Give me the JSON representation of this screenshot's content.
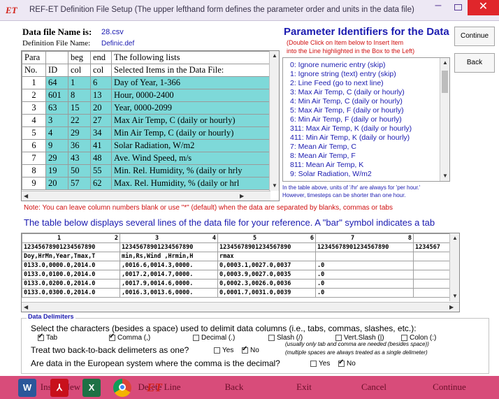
{
  "window": {
    "title": "REF-ET Definition File Setup   (The upper lefthand form defines the parameter order and units in the data file)",
    "app_icon": "ET"
  },
  "file": {
    "data_file_label": "Data file Name is:",
    "data_file_value": "28.csv",
    "def_file_label": "Definition File Name:",
    "def_file_value": "Definic.def"
  },
  "param_table": {
    "header1": [
      "Para",
      "",
      "beg",
      "end",
      "The following lists"
    ],
    "header2": [
      "No.",
      "ID",
      "col",
      "col",
      "Selected Items in the Data File:"
    ],
    "rows": [
      {
        "no": "1",
        "id": "64",
        "beg": "1",
        "end": "6",
        "item": "Day of Year, 1-366"
      },
      {
        "no": "2",
        "id": "601",
        "beg": "8",
        "end": "13",
        "item": "Hour, 0000-2400"
      },
      {
        "no": "3",
        "id": "63",
        "beg": "15",
        "end": "20",
        "item": "Year, 0000-2099"
      },
      {
        "no": "4",
        "id": "3",
        "beg": "22",
        "end": "27",
        "item": "Max Air Temp, C (daily or hourly)"
      },
      {
        "no": "5",
        "id": "4",
        "beg": "29",
        "end": "34",
        "item": "Min Air Temp, C (daily or hourly)"
      },
      {
        "no": "6",
        "id": "9",
        "beg": "36",
        "end": "41",
        "item": "Solar Radiation, W/m2"
      },
      {
        "no": "7",
        "id": "29",
        "beg": "43",
        "end": "48",
        "item": "Ave. Wind Speed, m/s"
      },
      {
        "no": "8",
        "id": "19",
        "beg": "50",
        "end": "55",
        "item": "Min. Rel. Humidity, % (daily or hrly"
      },
      {
        "no": "9",
        "id": "20",
        "beg": "57",
        "end": "62",
        "item": "Max. Rel. Humidity, % (daily or hrl"
      }
    ]
  },
  "param_ids": {
    "title": "Parameter Identifiers for the Data",
    "instr1": "(Double Click on Item below to Insert Item",
    "instr2": "into the Line highlighted in the Box to the Left)",
    "items": [
      "0:    Ignore numeric entry (skip)",
      "1:    Ignore string (text) entry (skip)",
      "2:    Line Feed (go to next line)",
      "3:    Max Air Temp, C (daily or hourly)",
      "4:    Min Air Temp, C (daily or hourly)",
      "5:    Max Air Temp, F (daily or hourly)",
      "6:    Min Air Temp, F (daily or hourly)",
      "311: Max Air Temp, K (daily or hourly)",
      "411: Min Air Temp, K (daily or hourly)",
      "7:    Mean Air Temp, C",
      "8:    Mean Air Temp, F",
      "811: Mean Air Temp, K",
      "9:    Solar Radiation, W/m2"
    ],
    "note1": "In the table above, units of '/hr' are always for 'per hour.'",
    "note2": "However, timesteps can be shorter than one hour."
  },
  "side_buttons": {
    "continue": "Continue",
    "back": "Back"
  },
  "note": "Note: You can leave column numbers blank or use \"*\" (default) when the data are separated by blanks, commas or tabs",
  "preview": {
    "caption": "The table below displays several lines of the data file for your reference. A \"bar\" symbol indicates a tab",
    "ruler_cols": [
      [
        "1",
        "2"
      ],
      [
        "3",
        "4"
      ],
      [
        "5",
        "6"
      ],
      [
        "7",
        "8"
      ]
    ],
    "digits": [
      "12345678901234567890",
      "12345678901234567890",
      "12345678901234567890",
      "12345678901234567890",
      "1234567"
    ],
    "lines": [
      [
        "Doy,HrMn,Year,Tmax,T",
        "min,Rs,Wind ,Hrmin,H",
        "rmax",
        "",
        ""
      ],
      [
        "0133.0,0000.0,2014.0",
        ",0016.6,0014.3,0000.",
        "0,0003.1,0027.0,0037",
        ".0",
        ""
      ],
      [
        "0133.0,0100.0,2014.0",
        ",0017.2,0014.7,0000.",
        "0,0003.9,0027.0,0035",
        ".0",
        ""
      ],
      [
        "0133.0,0200.0,2014.0",
        ",0017.9,0014.6,0000.",
        "0,0002.3,0026.0,0036",
        ".0",
        ""
      ],
      [
        "0133.0,0300.0,2014.0",
        ",0016.3,0013.6,0000.",
        "0,0001.7,0031.0,0039",
        ".0",
        ""
      ]
    ]
  },
  "delimiters": {
    "section_title": "Data Delimiters",
    "select_prompt": "Select the characters (besides a space) used to delimit data columns (i.e., tabs, commas, slashes, etc.):",
    "options": [
      {
        "label": "Tab",
        "checked": true
      },
      {
        "label": "Comma (,)",
        "checked": true
      },
      {
        "label": "Decimal (.)",
        "checked": false
      },
      {
        "label": "Slash (/)",
        "checked": false
      },
      {
        "label": "Vert.Slash (|)",
        "checked": false
      },
      {
        "label": "Colon (:)",
        "checked": false
      }
    ],
    "hint1": "(usually only tab and comma are needed (besides space))",
    "back_to_back": "Treat two back-to-back delimeters as one?",
    "hint2": "(multiple spaces are always treated as a single delimeter)",
    "european": "Are data in the European system where the comma is the decimal?",
    "yes": "Yes",
    "no": "No",
    "b2b_yes": false,
    "b2b_no": true,
    "eu_yes": false,
    "eu_no": true
  },
  "bottom_buttons": {
    "insert": "Insert New Line",
    "delete": "Delete Line",
    "back": "Back",
    "exit": "Exit",
    "cancel": "Cancel",
    "continue": "Continue"
  },
  "taskbar": [
    "word-icon",
    "acrobat-icon",
    "excel-icon",
    "chrome-icon",
    "ref-et-icon"
  ],
  "colors": {
    "accent_teal": "#7ed9d9",
    "title_blue": "#1b1bb0",
    "warning_red": "#d01010",
    "taskbar_pink": "#d84c7a"
  }
}
